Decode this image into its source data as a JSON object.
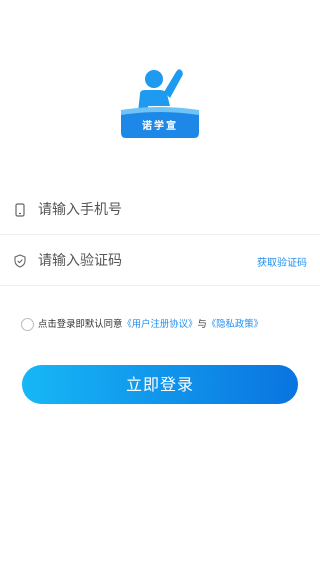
{
  "logo": {
    "text": "诺学宣"
  },
  "phone": {
    "placeholder": "请输入手机号",
    "value": ""
  },
  "code": {
    "placeholder": "请输入验证码",
    "value": "",
    "get_code_label": "获取验证码"
  },
  "agreement": {
    "prefix": "点击登录即默认同意",
    "user_agreement": "《用户注册协议》",
    "joiner": "与",
    "privacy_policy": "《隐私政策》",
    "checked": false
  },
  "login_button": {
    "label": "立即登录"
  },
  "colors": {
    "accent": "#1e8ef0",
    "gradient_start": "#17b7f6",
    "gradient_end": "#0a74e0"
  },
  "icons": {
    "phone": "phone-icon",
    "code": "shield-icon",
    "logo": "student-raising-hand-logo"
  }
}
